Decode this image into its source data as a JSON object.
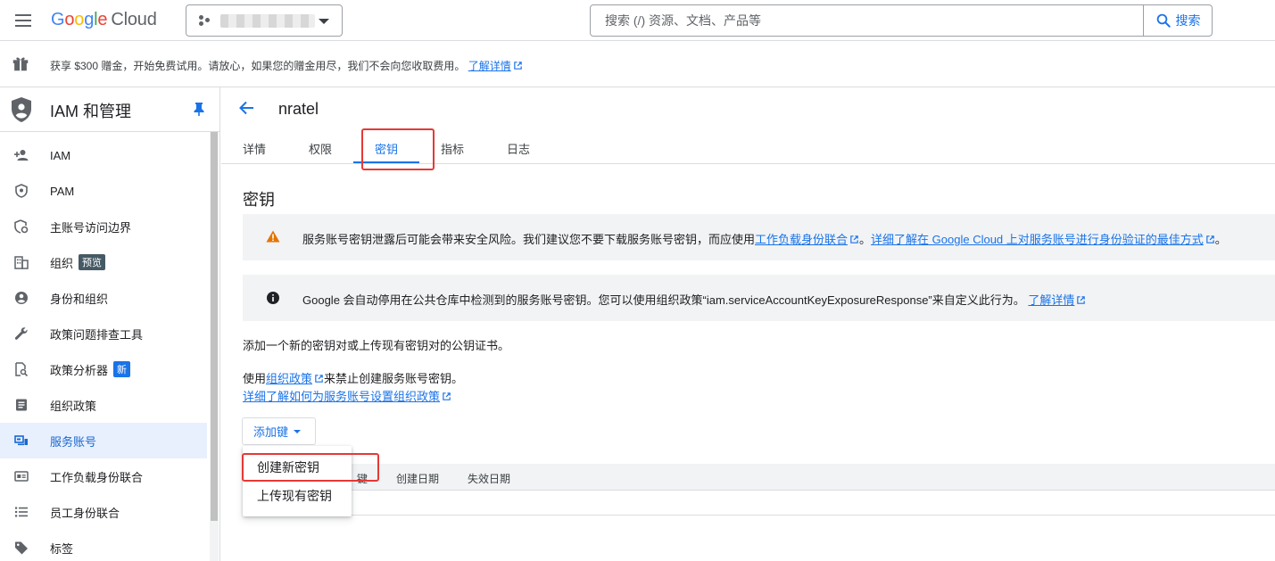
{
  "header": {
    "logo": {
      "g1": "G",
      "g2": "o",
      "g3": "o",
      "g4": "g",
      "g5": "l",
      "g6": "e",
      "cloud": "Cloud"
    },
    "search": {
      "placeholder": "搜索 (/) 资源、文档、产品等",
      "button_label": "搜索"
    }
  },
  "promo": {
    "text": "获享 $300 赠金，开始免费试用。请放心，如果您的赠金用尽，我们不会向您收取费用。",
    "link": "了解详情"
  },
  "sidebar": {
    "title": "IAM 和管理",
    "items": [
      {
        "label": "IAM",
        "icon": "person-add-icon"
      },
      {
        "label": "PAM",
        "icon": "shield-icon"
      },
      {
        "label": "主账号访问边界",
        "icon": "principal-boundary-icon"
      },
      {
        "label": "组织",
        "icon": "organization-icon",
        "badge": "预览"
      },
      {
        "label": "身份和组织",
        "icon": "account-circle-icon"
      },
      {
        "label": "政策问题排查工具",
        "icon": "wrench-icon"
      },
      {
        "label": "政策分析器",
        "icon": "policy-analyzer-icon",
        "badge": "新"
      },
      {
        "label": "组织政策",
        "icon": "document-icon"
      },
      {
        "label": "服务账号",
        "icon": "service-account-icon",
        "active": true
      },
      {
        "label": "工作负载身份联合",
        "icon": "id-card-icon"
      },
      {
        "label": "员工身份联合",
        "icon": "list-icon"
      },
      {
        "label": "标签",
        "icon": "tag-icon"
      }
    ]
  },
  "main": {
    "service_account_name": "nratel",
    "tabs": [
      "详情",
      "权限",
      "密钥",
      "指标",
      "日志"
    ],
    "active_tab": "密钥",
    "section_title": "密钥",
    "warning": {
      "text_before": "服务账号密钥泄露后可能会带来安全风险。我们建议您不要下载服务账号密钥，而应使用",
      "link1": "工作负载身份联合",
      "text_mid": "。",
      "link2": "详细了解在 Google Cloud 上对服务账号进行身份验证的最佳方式",
      "text_after": "。"
    },
    "info": {
      "text": "Google 会自动停用在公共仓库中检测到的服务账号密钥。您可以使用组织政策“iam.serviceAccountKeyExposureResponse”来自定义此行为。",
      "link": "了解详情"
    },
    "description": "添加一个新的密钥对或上传现有密钥对的公钥证书。",
    "org_policy_prefix": "使用",
    "org_policy_link": "组织政策",
    "org_policy_suffix": "来禁止创建服务账号密钥。",
    "learn_more_link": "详细了解如何为服务账号设置组织政策",
    "add_key_button": "添加键",
    "table_columns": [
      "键",
      "创建日期",
      "失效日期"
    ],
    "dropdown": [
      "创建新密钥",
      "上传现有密钥"
    ]
  },
  "colors": {
    "accent": "#1a73e8",
    "highlight_box": "#e53935",
    "warning": "#e37400"
  }
}
